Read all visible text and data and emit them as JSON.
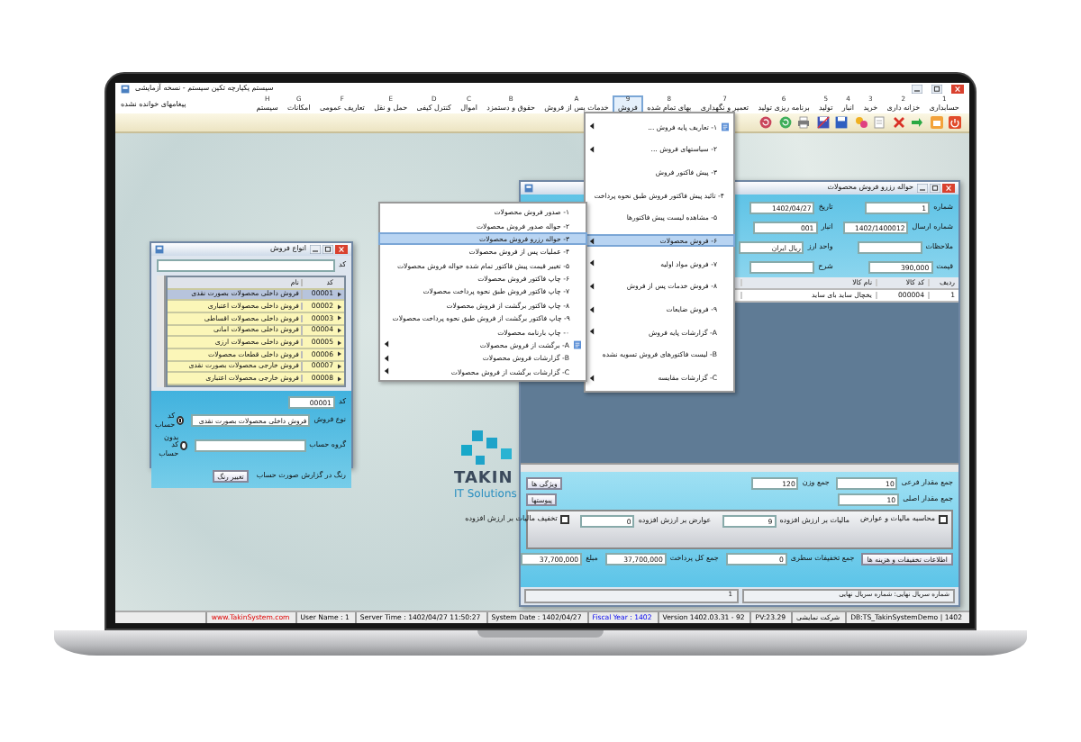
{
  "window": {
    "title": "سیستم یکپارچه تکین سیستم - نسخه آزمایشی",
    "unread_messages": "پیغامهای خوانده نشده"
  },
  "menu_bar": [
    {
      "key": "1",
      "label": "حسابداری",
      "selected": false
    },
    {
      "key": "2",
      "label": "خزانه داری",
      "selected": false
    },
    {
      "key": "3",
      "label": "خرید",
      "selected": false
    },
    {
      "key": "4",
      "label": "انبار",
      "selected": false
    },
    {
      "key": "5",
      "label": "تولید",
      "selected": false
    },
    {
      "key": "6",
      "label": "برنامه ریزی تولید",
      "selected": false
    },
    {
      "key": "7",
      "label": "تعمیر و نگهداری",
      "selected": false
    },
    {
      "key": "8",
      "label": "بهای تمام شده",
      "selected": false
    },
    {
      "key": "9",
      "label": "فروش",
      "selected": true
    },
    {
      "key": "A",
      "label": "خدمات پس از فروش",
      "selected": false
    },
    {
      "key": "B",
      "label": "حقوق و دستمزد",
      "selected": false
    },
    {
      "key": "C",
      "label": "اموال",
      "selected": false
    },
    {
      "key": "D",
      "label": "کنترل کیفی",
      "selected": false
    },
    {
      "key": "E",
      "label": "حمل و نقل",
      "selected": false
    },
    {
      "key": "F",
      "label": "تعاریف عمومی",
      "selected": false
    },
    {
      "key": "G",
      "label": "امکانات",
      "selected": false
    },
    {
      "key": "H",
      "label": "سیستم",
      "selected": false
    }
  ],
  "sales_menu": [
    {
      "label": "۱- تعاریف پایه فروش ...",
      "has_submenu": true,
      "has_icon": true,
      "selected": false
    },
    {
      "label": "۲- سیاستهای فروش ...",
      "has_submenu": true,
      "has_icon": false,
      "selected": false
    },
    {
      "label": "۳- پیش فاکتور فروش",
      "has_submenu": false,
      "has_icon": false,
      "selected": false
    },
    {
      "label": "۴- تائید پیش فاکتور فروش طبق نحوه پرداخت",
      "has_submenu": false,
      "has_icon": false,
      "selected": false
    },
    {
      "label": "۵- مشاهده لیست پیش فاکتورها",
      "has_submenu": false,
      "has_icon": false,
      "selected": false
    },
    {
      "label": "۶- فروش محصولات",
      "has_submenu": true,
      "has_icon": false,
      "selected": true
    },
    {
      "label": "۷- فروش مواد اولیه",
      "has_submenu": true,
      "has_icon": false,
      "selected": false
    },
    {
      "label": "۸- فروش خدمات پس از فروش",
      "has_submenu": true,
      "has_icon": false,
      "selected": false
    },
    {
      "label": "۹- فروش ضایعات",
      "has_submenu": true,
      "has_icon": false,
      "selected": false
    },
    {
      "label": "A- گزارشات پایه فروش",
      "has_submenu": true,
      "has_icon": false,
      "selected": false
    },
    {
      "label": "B- لیست فاکتورهای فروش تسویه نشده",
      "has_submenu": false,
      "has_icon": false,
      "selected": false
    },
    {
      "label": "C- گزارشات مقایسه",
      "has_submenu": true,
      "has_icon": false,
      "selected": false
    }
  ],
  "products_submenu": [
    {
      "label": "۱- صدور فروش محصولات",
      "has_submenu": false,
      "has_icon": false,
      "selected": false
    },
    {
      "label": "۲- حواله صدور فروش محصولات",
      "has_submenu": false,
      "has_icon": false,
      "selected": false
    },
    {
      "label": "۳- حواله رزرو فروش محصولات",
      "has_submenu": false,
      "has_icon": false,
      "selected": true
    },
    {
      "label": "۴- عملیات پس از فروش محصولات",
      "has_submenu": false,
      "has_icon": false,
      "selected": false
    },
    {
      "label": "۵- تغییر قیمت پیش فاکتور تمام شده حواله فروش محصولات",
      "has_submenu": false,
      "has_icon": false,
      "selected": false
    },
    {
      "label": "۶- چاپ فاکتور فروش محصولات",
      "has_submenu": false,
      "has_icon": false,
      "selected": false
    },
    {
      "label": "۷- چاپ فاکتور فروش طبق نحوه پرداخت محصولات",
      "has_submenu": false,
      "has_icon": false,
      "selected": false
    },
    {
      "label": "۸- چاپ فاکتور برگشت از فروش محصولات",
      "has_submenu": false,
      "has_icon": false,
      "selected": false
    },
    {
      "label": "۹- چاپ فاکتور برگشت از فروش طبق نحوه پرداخت محصولات",
      "has_submenu": false,
      "has_icon": false,
      "selected": false
    },
    {
      "label": "۰- چاپ بارنامه محصولات",
      "has_submenu": false,
      "has_icon": false,
      "selected": false
    },
    {
      "label": "A- برگشت از فروش محصولات",
      "has_submenu": true,
      "has_icon": true,
      "selected": false
    },
    {
      "label": "B- گزارشات فروش محصولات",
      "has_submenu": true,
      "has_icon": false,
      "selected": false
    },
    {
      "label": "C- گزارشات برگشت از فروش محصولات",
      "has_submenu": true,
      "has_icon": false,
      "selected": false
    }
  ],
  "sale_types_window": {
    "title": "انواع فروش",
    "search_label": "کد",
    "columns": [
      "کد",
      "نام"
    ],
    "rows": [
      {
        "cells": [
          "00001",
          "فروش داخلی محصولات بصورت نقدی"
        ],
        "selected": true
      },
      {
        "cells": [
          "00002",
          "فروش داخلی محصولات اعتباری"
        ],
        "selected": false
      },
      {
        "cells": [
          "00003",
          "فروش داخلی محصولات اقساطی"
        ],
        "selected": false
      },
      {
        "cells": [
          "00004",
          "فروش داخلی محصولات امانی"
        ],
        "selected": false
      },
      {
        "cells": [
          "00005",
          "فروش داخلی محصولات ارزی"
        ],
        "selected": false
      },
      {
        "cells": [
          "00006",
          "فروش داخلی قطعات محصولات"
        ],
        "selected": false
      },
      {
        "cells": [
          "00007",
          "فروش خارجی محصولات بصورت نقدی"
        ],
        "selected": false
      },
      {
        "cells": [
          "00008",
          "فروش خارجی محصولات اعتباری"
        ],
        "selected": false
      }
    ],
    "fields": [
      {
        "label": "کد",
        "value": "00001"
      },
      {
        "label": "نوع فروش",
        "value": "فروش داخلی محصولات بصورت نقدی"
      },
      {
        "label": "گروه حساب"
      }
    ],
    "radios": [
      {
        "label": "کد حساب",
        "selected": true
      },
      {
        "label": "بدون کد حساب",
        "selected": false
      }
    ],
    "color_label": "رنگ در گزارش صورت حساب",
    "color_button": "تغییر رنگ"
  },
  "voucher_window": {
    "title": "حواله رزرو فروش محصولات",
    "fields": [
      {
        "label": "شماره",
        "value": "1"
      },
      {
        "label": "تاریخ",
        "value": "1402/04/27"
      },
      {
        "label": "شماره ارسال",
        "value": "1402/1400012"
      },
      {
        "label": "انبار",
        "value": "001"
      },
      {
        "label": "ملاحظات"
      },
      {
        "label": "واحد ارز",
        "value": "ریال ایران"
      },
      {
        "label": "قیمت",
        "value": "390,000"
      },
      {
        "label": "شرح"
      }
    ],
    "columns": [
      "ردیف",
      "کد کالا",
      "نام کالا"
    ],
    "rows": [
      {
        "cells": [
          "1",
          "000004",
          "یخچال ساید بای ساید"
        ],
        "selected": false
      }
    ],
    "totals": [
      {
        "label": "جمع مقدار فرعی",
        "value": "10"
      },
      {
        "label": "جمع وزن",
        "value": "120"
      },
      {
        "label": "جمع مقدار اصلی",
        "value": "10"
      }
    ],
    "buttons": [
      "ویژگی ها",
      "پیوستها"
    ],
    "tax_options": [
      {
        "label": "محاسبه مالیات و عوارض",
        "checked": false
      },
      {
        "label": "تخفیف مالیات بر ارزش افزوده",
        "checked": false
      }
    ],
    "tax_fields": [
      {
        "label": "مالیات بر ارزش افزوده",
        "value": "9"
      },
      {
        "label": "عوارض بر ارزش افزوده",
        "value": "0"
      }
    ],
    "discount_button": "اطلاعات تخفیفات و هزینه ها",
    "payment_fields": [
      {
        "label": "جمع تخفیفات سطری",
        "value": "0"
      },
      {
        "label": "جمع کل پرداخت",
        "value": "37,700,000"
      },
      {
        "label": "مبلغ",
        "value": "37,700,000"
      }
    ],
    "status": [
      "شماره سریال نهایی: شماره سریال نهایی",
      "1"
    ]
  },
  "logo": {
    "name": "TAKIN",
    "tagline": "IT Solutions"
  },
  "status_bar": [
    {
      "text": "DB:TS_TakinSystemDemo | 1402",
      "kind": "plain"
    },
    {
      "text": "شرکت نمایشی",
      "kind": "plain"
    },
    {
      "text": "PV:23.29",
      "kind": "plain"
    },
    {
      "text": "Version 1402.03.31 - 92",
      "kind": "plain"
    },
    {
      "text": "Fiscal Year : 1402",
      "kind": "info"
    },
    {
      "text": "System Date : 1402/04/27",
      "kind": "plain"
    },
    {
      "text": "Server Time : 1402/04/27 11:50:27",
      "kind": "plain"
    },
    {
      "text": "User Name : 1",
      "kind": "plain"
    },
    {
      "text": "www.TakinSystem.com",
      "kind": "link"
    }
  ]
}
